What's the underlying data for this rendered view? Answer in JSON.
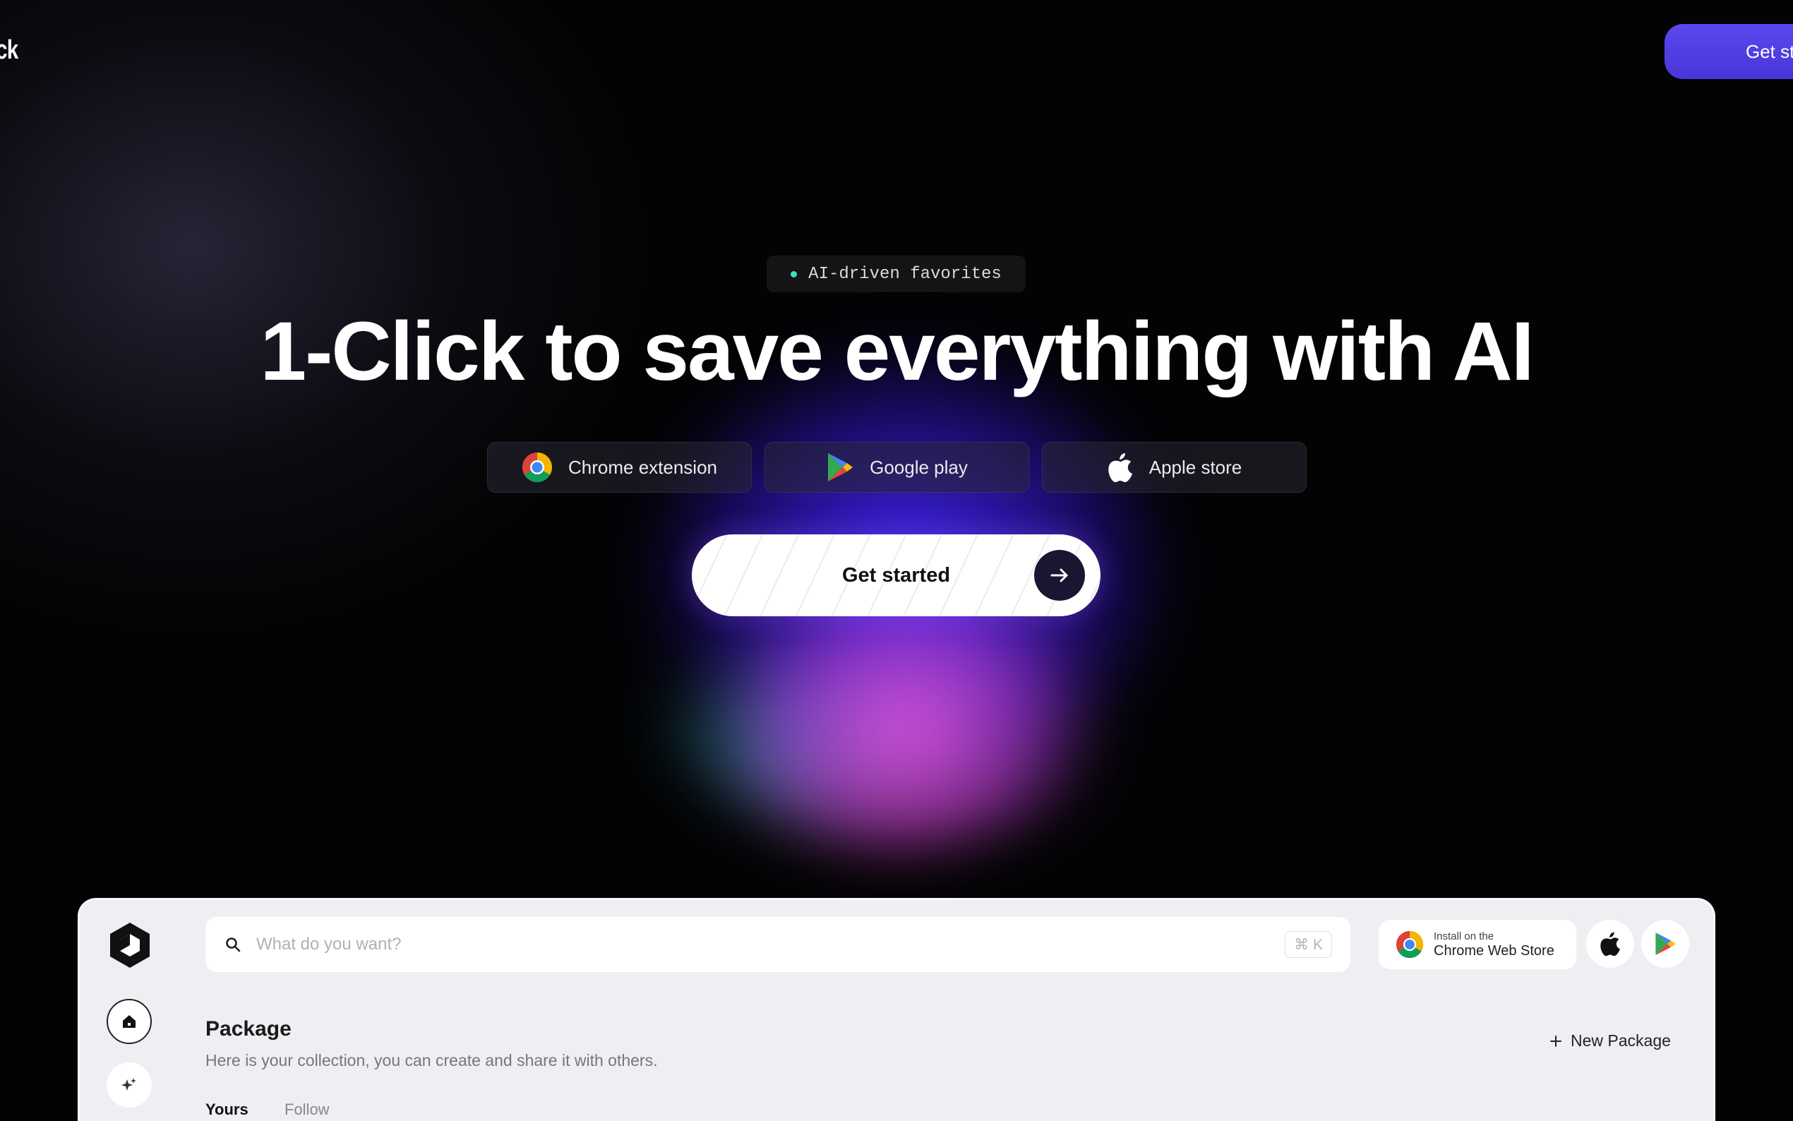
{
  "nav": {
    "logo_text": "ck",
    "cta_label": "Get st"
  },
  "hero": {
    "badge": "AI-driven favorites",
    "title": "1-Click to save everything with AI",
    "stores": [
      {
        "label": "Chrome extension",
        "icon": "chrome-icon"
      },
      {
        "label": "Google play",
        "icon": "google-play-icon"
      },
      {
        "label": "Apple store",
        "icon": "apple-icon"
      }
    ],
    "cta_label": "Get started"
  },
  "app": {
    "search": {
      "placeholder": "What do you want?",
      "shortcut": "⌘ K"
    },
    "chrome_store": {
      "small": "Install on the",
      "big": "Chrome Web Store"
    },
    "package": {
      "title": "Package",
      "description": "Here is your collection, you can create and share it with others.",
      "new_button": "New Package"
    },
    "tabs": [
      "Yours",
      "Follow"
    ]
  },
  "colors": {
    "background": "#030304",
    "accent": "#5b48ee",
    "badge_dot": "#3ee0c0",
    "panel": "#efeff3"
  }
}
